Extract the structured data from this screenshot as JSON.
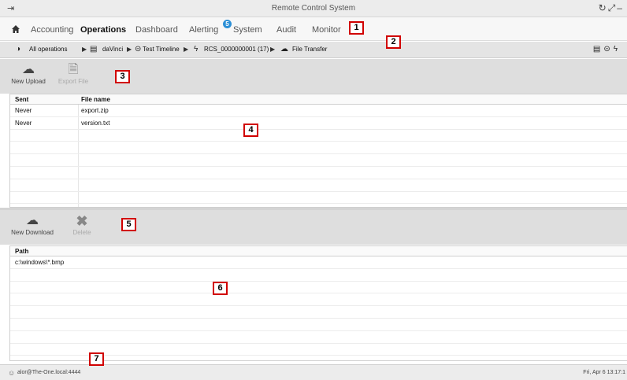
{
  "window": {
    "title": "Remote Control System",
    "logout_icon": "logout-icon",
    "controls_icon": "window-controls-icon"
  },
  "menu": {
    "home_icon": "home-icon",
    "items": [
      {
        "label": "Accounting"
      },
      {
        "label": "Operations",
        "active": true
      },
      {
        "label": "Dashboard"
      },
      {
        "label": "Alerting",
        "badge": "5"
      },
      {
        "label": "System"
      },
      {
        "label": "Audit"
      },
      {
        "label": "Monitor"
      }
    ]
  },
  "breadcrumb": {
    "items": [
      {
        "icon": "operations-icon",
        "label": "All operations"
      },
      {
        "icon": "folder-icon",
        "label": "daVinci"
      },
      {
        "icon": "target-icon",
        "label": "Test Timeline"
      },
      {
        "icon": "bolt-icon",
        "label": "RCS_0000000001 (17)"
      },
      {
        "icon": "cloud-icon",
        "label": "File Transfer"
      }
    ]
  },
  "upload_toolbar": {
    "new_upload": "New Upload",
    "export_file": "Export File"
  },
  "upload_table": {
    "columns": [
      "Sent",
      "File name"
    ],
    "rows": [
      {
        "sent": "Never",
        "file": "export.zip"
      },
      {
        "sent": "Never",
        "file": "version.txt"
      }
    ]
  },
  "download_toolbar": {
    "new_download": "New Download",
    "delete": "Delete"
  },
  "download_table": {
    "columns": [
      "Path"
    ],
    "rows": [
      {
        "path": "c:\\windows\\*.bmp"
      }
    ]
  },
  "status": {
    "user": "alor@The-One.local:4444",
    "time": "Fri, Apr 6  13:17:1"
  },
  "callouts": [
    "1",
    "2",
    "3",
    "4",
    "5",
    "6",
    "7"
  ]
}
